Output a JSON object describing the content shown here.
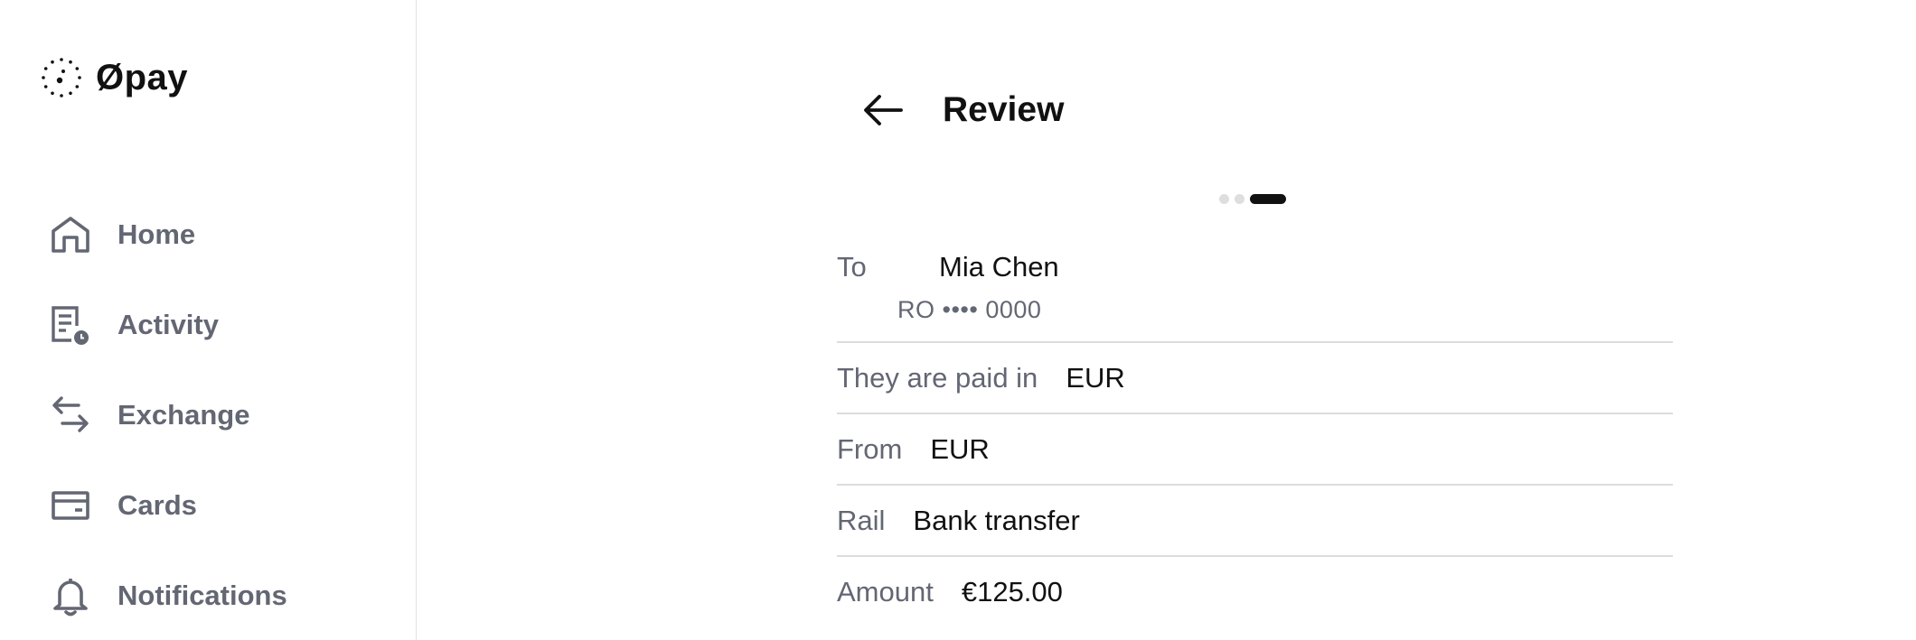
{
  "brand": {
    "name": "Øpay",
    "logo_icon": "dotted-circle-logo-icon"
  },
  "sidebar": {
    "items": [
      {
        "label": "Home",
        "icon": "home-icon"
      },
      {
        "label": "Activity",
        "icon": "activity-icon"
      },
      {
        "label": "Exchange",
        "icon": "exchange-icon"
      },
      {
        "label": "Cards",
        "icon": "card-icon"
      },
      {
        "label": "Notifications",
        "icon": "bell-icon"
      }
    ]
  },
  "review": {
    "title": "Review",
    "back_icon": "arrow-left-icon",
    "steps": {
      "total": 3,
      "current": 3
    },
    "to_label": "To",
    "to_name": "Mia Chen",
    "to_account": "RO •••• 0000",
    "paid_in_label": "They are paid in",
    "paid_in_value": "EUR",
    "from_label": "From",
    "from_value": "EUR",
    "rail_label": "Rail",
    "rail_value": "Bank transfer",
    "amount_label": "Amount",
    "amount_value": "€125.00"
  },
  "colors": {
    "text_primary": "#111111",
    "text_secondary": "#636773",
    "divider": "#dcdcdc",
    "step_inactive": "#dedede",
    "step_active": "#111111"
  }
}
